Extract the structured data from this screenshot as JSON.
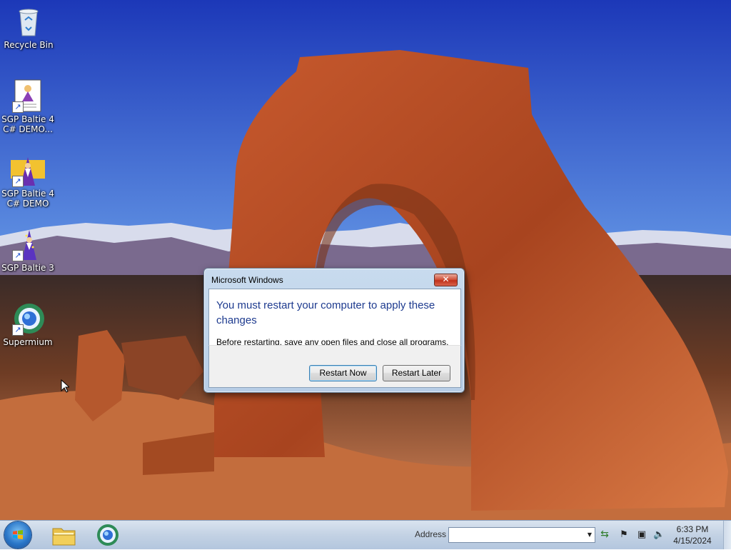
{
  "desktop": {
    "icons": [
      {
        "label": "Recycle Bin",
        "icon": "recycle-bin-icon"
      },
      {
        "label": "SGP Baltie 4 C# DEMO...",
        "icon": "document-wizard-icon"
      },
      {
        "label": "SGP Baltie 4 C# DEMO",
        "icon": "wizard-icon"
      },
      {
        "label": "SGP Baltie 3",
        "icon": "wizard-icon"
      },
      {
        "label": "Supermium",
        "icon": "browser-globe-icon"
      }
    ]
  },
  "dialog": {
    "title": "Microsoft Windows",
    "close_glyph": "✕",
    "heading": "You must restart your computer to apply these changes",
    "message": "Before restarting, save any open files and close all programs.",
    "buttons": {
      "restart_now": "Restart Now",
      "restart_later": "Restart Later"
    }
  },
  "taskbar": {
    "start_label": "Start",
    "apps": [
      {
        "name": "Windows Explorer",
        "icon": "folder-icon"
      },
      {
        "name": "Supermium",
        "icon": "browser-globe-icon"
      }
    ],
    "address": {
      "label": "Address",
      "value": "",
      "drop_glyph": "▼",
      "go_glyph": "⇆"
    },
    "tray": {
      "flag_glyph": "⚑",
      "network_glyph": "▣",
      "volume_glyph": "🔈"
    },
    "clock": {
      "time": "6:33 PM",
      "date": "4/15/2024"
    }
  },
  "colors": {
    "dialog_heading": "#1e3b8f",
    "close_button": "#c0311b",
    "taskbar": "#c3d2e4"
  }
}
